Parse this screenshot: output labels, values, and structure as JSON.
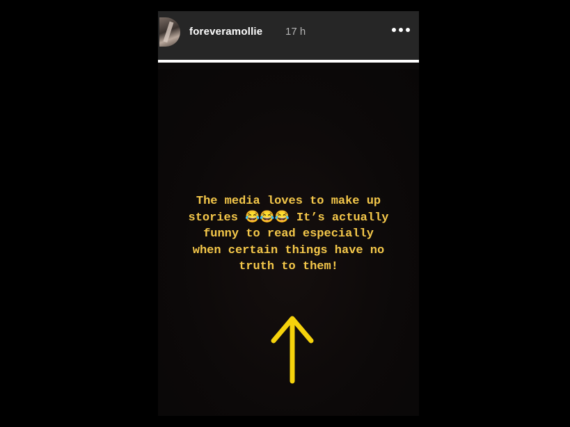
{
  "story": {
    "username": "foreveramollie",
    "timestamp": "17 h",
    "more_icon": "more-horizontal-icon",
    "progress": 1.0,
    "caption": "The media loves to make up\nstories 😂😂😂 It’s actually\nfunny to read especially\nwhen certain things have no\ntruth to them!",
    "caption_color": "#f5c84a",
    "arrow_icon": "arrow-up-icon",
    "arrow_color": "#f5d20c"
  }
}
